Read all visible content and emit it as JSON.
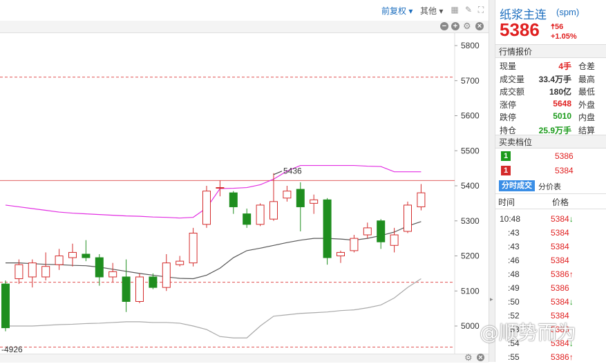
{
  "toolbar": {
    "adjust_label": "前复权",
    "other_label": "其他"
  },
  "chart_data": {
    "type": "candlestick",
    "y_axis_ticks": [
      "5800",
      "5700",
      "5600",
      "5500",
      "5400",
      "5300",
      "5200",
      "5100",
      "5000"
    ],
    "ylim": [
      4926,
      5830
    ],
    "high_annotation": "5436",
    "low_annotation": "4926",
    "reference_lines": {
      "upper_dashed": 5710,
      "price_line": 5415,
      "lower_dashed": 5125,
      "bottom_dashed": 4940
    },
    "candles": [
      {
        "o": 5120,
        "c": 4995,
        "h": 5130,
        "l": 4985
      },
      {
        "o": 5135,
        "c": 5175,
        "h": 5190,
        "l": 5120
      },
      {
        "o": 5140,
        "c": 5180,
        "h": 5190,
        "l": 5110
      },
      {
        "o": 5140,
        "c": 5170,
        "h": 5210,
        "l": 5130
      },
      {
        "o": 5175,
        "c": 5200,
        "h": 5220,
        "l": 5160
      },
      {
        "o": 5195,
        "c": 5210,
        "h": 5235,
        "l": 5170
      },
      {
        "o": 5205,
        "c": 5195,
        "h": 5245,
        "l": 5185
      },
      {
        "o": 5195,
        "c": 5140,
        "h": 5205,
        "l": 5115
      },
      {
        "o": 5140,
        "c": 5155,
        "h": 5180,
        "l": 5125
      },
      {
        "o": 5140,
        "c": 5070,
        "h": 5190,
        "l": 5040
      },
      {
        "o": 5070,
        "c": 5140,
        "h": 5150,
        "l": 5065
      },
      {
        "o": 5140,
        "c": 5110,
        "h": 5150,
        "l": 5105
      },
      {
        "o": 5110,
        "c": 5180,
        "h": 5205,
        "l": 5100
      },
      {
        "o": 5175,
        "c": 5185,
        "h": 5200,
        "l": 5170
      },
      {
        "o": 5180,
        "c": 5265,
        "h": 5280,
        "l": 5170
      },
      {
        "o": 5290,
        "c": 5385,
        "h": 5400,
        "l": 5280
      },
      {
        "o": 5395,
        "c": 5395,
        "h": 5415,
        "l": 5370
      },
      {
        "o": 5380,
        "c": 5340,
        "h": 5385,
        "l": 5320
      },
      {
        "o": 5320,
        "c": 5290,
        "h": 5335,
        "l": 5280
      },
      {
        "o": 5290,
        "c": 5345,
        "h": 5350,
        "l": 5285
      },
      {
        "o": 5305,
        "c": 5355,
        "h": 5436,
        "l": 5300
      },
      {
        "o": 5365,
        "c": 5385,
        "h": 5400,
        "l": 5355
      },
      {
        "o": 5390,
        "c": 5340,
        "h": 5410,
        "l": 5270
      },
      {
        "o": 5350,
        "c": 5360,
        "h": 5375,
        "l": 5320
      },
      {
        "o": 5360,
        "c": 5195,
        "h": 5365,
        "l": 5175
      },
      {
        "o": 5200,
        "c": 5210,
        "h": 5215,
        "l": 5180
      },
      {
        "o": 5215,
        "c": 5250,
        "h": 5260,
        "l": 5210
      },
      {
        "o": 5260,
        "c": 5280,
        "h": 5295,
        "l": 5250
      },
      {
        "o": 5300,
        "c": 5240,
        "h": 5305,
        "l": 5220
      },
      {
        "o": 5230,
        "c": 5260,
        "h": 5280,
        "l": 5210
      },
      {
        "o": 5270,
        "c": 5345,
        "h": 5355,
        "l": 5265
      },
      {
        "o": 5340,
        "c": 5380,
        "h": 5405,
        "l": 5330
      }
    ],
    "ma_black": [
      5180,
      5180,
      5178,
      5176,
      5175,
      5173,
      5172,
      5168,
      5162,
      5156,
      5150,
      5145,
      5140,
      5136,
      5135,
      5145,
      5165,
      5195,
      5215,
      5222,
      5230,
      5238,
      5245,
      5250,
      5250,
      5248,
      5245,
      5250,
      5258,
      5268,
      5285,
      5298
    ],
    "ma_magenta": [
      5345,
      5340,
      5335,
      5330,
      5325,
      5322,
      5320,
      5318,
      5316,
      5314,
      5313,
      5311,
      5310,
      5308,
      5310,
      5337,
      5392,
      5393,
      5395,
      5403,
      5419,
      5442,
      5458,
      5458,
      5458,
      5458,
      5458,
      5456,
      5455,
      5440,
      5440,
      5440
    ],
    "ma_gray": [
      5000,
      5000,
      5000,
      5002,
      5004,
      5005,
      5007,
      5008,
      5010,
      5012,
      5012,
      5010,
      5010,
      5008,
      5000,
      4990,
      4970,
      4966,
      4966,
      5000,
      5028,
      5032,
      5036,
      5038,
      5040,
      5044,
      5046,
      5052,
      5060,
      5080,
      5110,
      5135
    ]
  },
  "quote": {
    "name": "纸浆主连",
    "code": "(spm)",
    "price": "5386",
    "change": "56",
    "change_pct": "+1.05%",
    "section_quote": "行情报价",
    "stats": [
      {
        "label": "现量",
        "value": "4手",
        "color": "red",
        "label2": "仓差"
      },
      {
        "label": "成交量",
        "value": "33.4万手",
        "color": "black",
        "label2": "最高"
      },
      {
        "label": "成交额",
        "value": "180亿",
        "color": "black",
        "label2": "最低"
      },
      {
        "label": "涨停",
        "value": "5648",
        "color": "red",
        "label2": "外盘"
      },
      {
        "label": "跌停",
        "value": "5010",
        "color": "green",
        "label2": "内盘"
      },
      {
        "label": "持仓",
        "value": "25.9万手",
        "color": "green",
        "label2": "结算"
      }
    ],
    "section_orderbook": "买卖档位",
    "orderbook": [
      {
        "badge": "1",
        "color": "green",
        "price": "5386"
      },
      {
        "badge": "1",
        "color": "red",
        "price": "5384"
      }
    ],
    "tab_active": "分时成交",
    "tab_other": "分价表",
    "tick_header_time": "时间",
    "tick_header_price": "价格",
    "ticks": [
      {
        "time": "10:48",
        "price": "5384",
        "dir": "↓"
      },
      {
        "time": ":43",
        "price": "5384",
        "dir": ""
      },
      {
        "time": ":43",
        "price": "5384",
        "dir": ""
      },
      {
        "time": ":46",
        "price": "5384",
        "dir": ""
      },
      {
        "time": ":48",
        "price": "5386",
        "dir": "↑"
      },
      {
        "time": ":49",
        "price": "5386",
        "dir": ""
      },
      {
        "time": ":50",
        "price": "5384",
        "dir": "↓"
      },
      {
        "time": ":52",
        "price": "5384",
        "dir": ""
      },
      {
        "time": ":53",
        "price": "5386",
        "dir": ""
      },
      {
        "time": ":54",
        "price": "5384",
        "dir": "↓"
      },
      {
        "time": ":55",
        "price": "5386",
        "dir": "↑"
      }
    ]
  },
  "watermark": "@顺势而为"
}
